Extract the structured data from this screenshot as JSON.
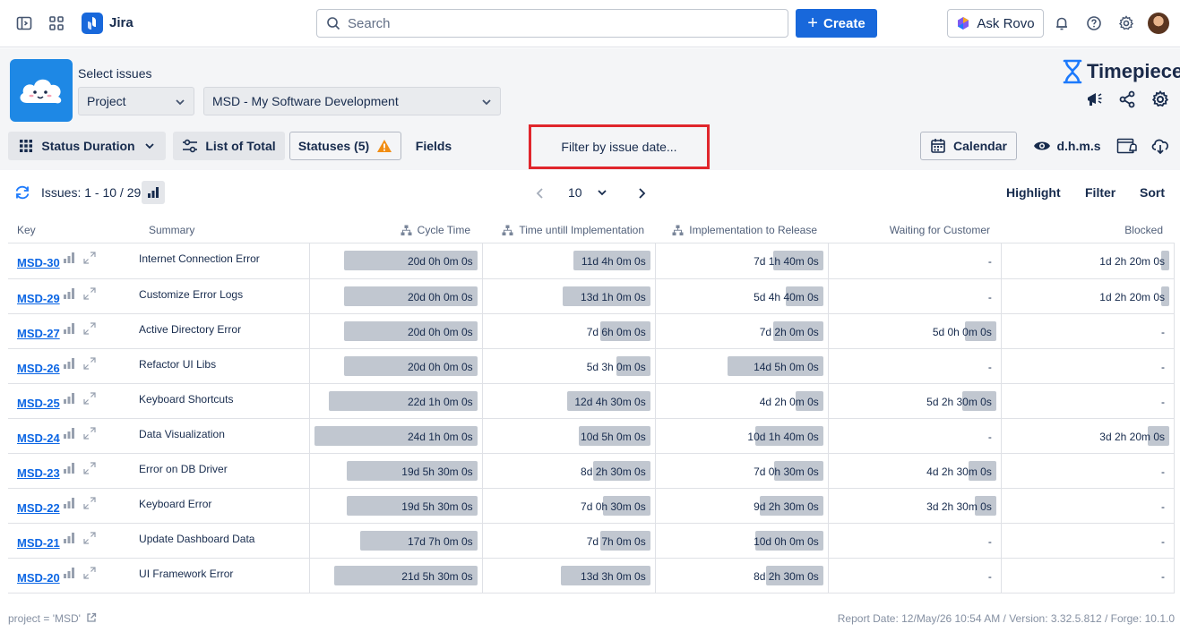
{
  "topbar": {
    "app_name": "Jira",
    "search_placeholder": "Search",
    "create_label": "Create",
    "rovo_label": "Ask Rovo"
  },
  "header": {
    "select_label": "Select issues",
    "scope_select": "Project",
    "project_select": "MSD - My Software Development",
    "brand": "Timepiece"
  },
  "toolbar": {
    "status_duration": "Status Duration",
    "list_of_total": "List of Total",
    "statuses": "Statuses (5)",
    "fields": "Fields",
    "filter_date": "Filter by issue date...",
    "calendar": "Calendar",
    "format": "d.h.m.s"
  },
  "pager": {
    "issues": "Issues: 1 - 10 / 29",
    "page_size": "10",
    "highlight": "Highlight",
    "filter": "Filter",
    "sort": "Sort"
  },
  "columns": {
    "key": "Key",
    "summary": "Summary",
    "c1": "Cycle Time",
    "c2": "Time untill Implementation",
    "c3": "Implementation to Release",
    "c4": "Waiting for Customer",
    "c5": "Blocked"
  },
  "rows": [
    {
      "key": "MSD-30",
      "summary": "Internet Connection Error",
      "v": [
        "20d 0h 0m 0s",
        "11d 4h 0m 0s",
        "7d 1h 40m 0s",
        "-",
        "1d 2h 20m 0s"
      ],
      "f": [
        0.82,
        0.47,
        0.31,
        0,
        0.05
      ]
    },
    {
      "key": "MSD-29",
      "summary": "Customize Error Logs",
      "v": [
        "20d 0h 0m 0s",
        "13d 1h 0m 0s",
        "5d 4h 40m 0s",
        "-",
        "1d 2h 20m 0s"
      ],
      "f": [
        0.82,
        0.54,
        0.23,
        0,
        0.05
      ]
    },
    {
      "key": "MSD-27",
      "summary": "Active Directory Error",
      "v": [
        "20d 0h 0m 0s",
        "7d 6h 0m 0s",
        "7d 2h 0m 0s",
        "5d 0h 0m 0s",
        "-"
      ],
      "f": [
        0.82,
        0.31,
        0.31,
        0.19,
        0
      ]
    },
    {
      "key": "MSD-26",
      "summary": "Refactor UI Libs",
      "v": [
        "20d 0h 0m 0s",
        "5d 3h 0m 0s",
        "14d 5h 0m 0s",
        "-",
        "-"
      ],
      "f": [
        0.82,
        0.21,
        0.59,
        0,
        0
      ]
    },
    {
      "key": "MSD-25",
      "summary": "Keyboard Shortcuts",
      "v": [
        "22d 1h 0m 0s",
        "12d 4h 30m 0s",
        "4d 2h 0m 0s",
        "5d 2h 30m 0s",
        "-"
      ],
      "f": [
        0.91,
        0.51,
        0.17,
        0.21,
        0
      ]
    },
    {
      "key": "MSD-24",
      "summary": "Data Visualization",
      "v": [
        "24d 1h 0m 0s",
        "10d 5h 0m 0s",
        "10d 1h 40m 0s",
        "-",
        "3d 2h 20m 0s"
      ],
      "f": [
        1.0,
        0.44,
        0.42,
        0,
        0.13
      ]
    },
    {
      "key": "MSD-23",
      "summary": "Error on DB Driver",
      "v": [
        "19d 5h 30m 0s",
        "8d 2h 30m 0s",
        "7d 0h 30m 0s",
        "4d 2h 30m 0s",
        "-"
      ],
      "f": [
        0.8,
        0.35,
        0.3,
        0.17,
        0
      ]
    },
    {
      "key": "MSD-22",
      "summary": "Keyboard Error",
      "v": [
        "19d 5h 30m 0s",
        "7d 0h 30m 0s",
        "9d 2h 30m 0s",
        "3d 2h 30m 0s",
        "-"
      ],
      "f": [
        0.8,
        0.29,
        0.39,
        0.13,
        0
      ]
    },
    {
      "key": "MSD-21",
      "summary": "Update Dashboard Data",
      "v": [
        "17d 7h 0m 0s",
        "7d 7h 0m 0s",
        "10d 0h 0m 0s",
        "-",
        "-"
      ],
      "f": [
        0.72,
        0.31,
        0.42,
        0,
        0
      ]
    },
    {
      "key": "MSD-20",
      "summary": "UI Framework Error",
      "v": [
        "21d 5h 30m 0s",
        "13d 3h 0m 0s",
        "8d 2h 30m 0s",
        "-",
        "-"
      ],
      "f": [
        0.88,
        0.55,
        0.35,
        0,
        0
      ]
    }
  ],
  "footer": {
    "jql": "project = 'MSD'",
    "report": "Report Date: 12/May/26 10:54 AM / Version: 3.32.5.812 / Forge: 10.1.0"
  }
}
